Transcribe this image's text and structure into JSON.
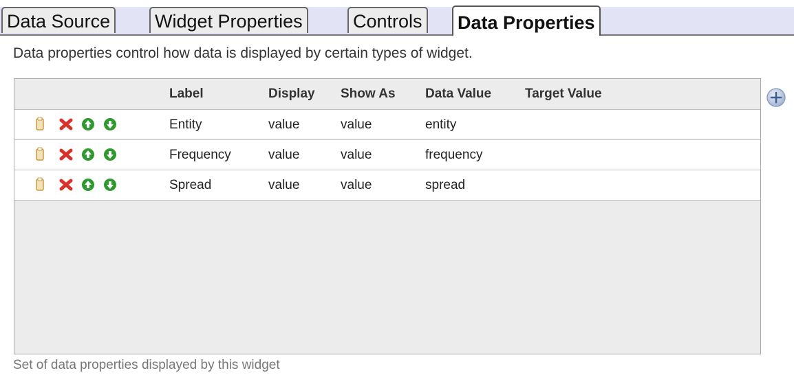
{
  "tabs": [
    {
      "label": "Data Source",
      "active": false
    },
    {
      "label": "Widget Properties",
      "active": false
    },
    {
      "label": "Controls",
      "active": false
    },
    {
      "label": "Data Properties",
      "active": true
    }
  ],
  "intro_text": "Data properties control how data is displayed by certain types of widget.",
  "table": {
    "columns": [
      "Label",
      "Display",
      "Show As",
      "Data Value",
      "Target Value"
    ],
    "rows": [
      {
        "label": "Entity",
        "display": "value",
        "show_as": "value",
        "data_value": "entity",
        "target_value": ""
      },
      {
        "label": "Frequency",
        "display": "value",
        "show_as": "value",
        "data_value": "frequency",
        "target_value": ""
      },
      {
        "label": "Spread",
        "display": "value",
        "show_as": "value",
        "data_value": "spread",
        "target_value": ""
      }
    ],
    "row_actions": [
      "copy-icon",
      "delete-icon",
      "move-up-icon",
      "move-down-icon"
    ]
  },
  "footer_note": "Set of data properties displayed by this widget",
  "add_button_icon": "plus-icon",
  "colors": {
    "tab_strip": "#e3e3f6",
    "delete": "#d9322b",
    "move": "#2e9a2e",
    "copy": "#e7c27a",
    "add_button": "#7d95ba"
  }
}
